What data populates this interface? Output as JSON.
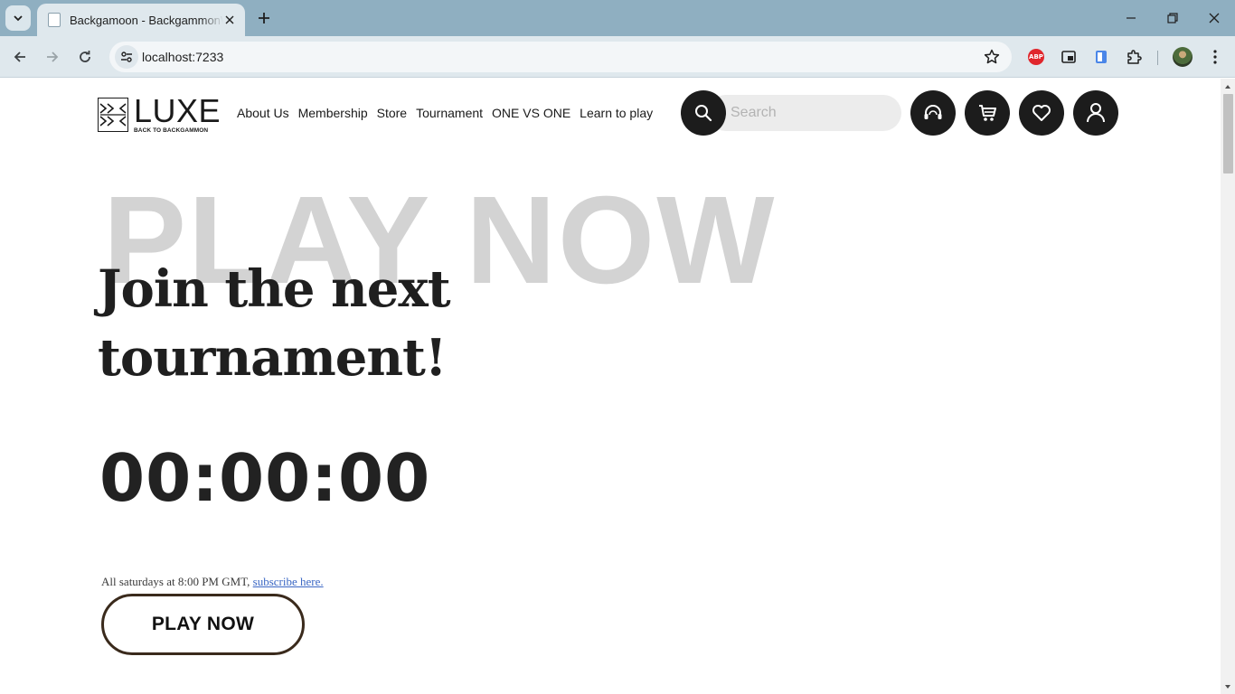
{
  "browser": {
    "tab_title": "Backgamoon - BackgammonWeb",
    "url": "localhost:7233",
    "icons": [
      "tab-search-icon",
      "favicon-icon",
      "close-icon",
      "plus-icon",
      "minimize-icon",
      "restore-icon",
      "window-close-icon",
      "back-icon",
      "forward-icon",
      "reload-icon",
      "site-info-icon",
      "star-icon",
      "adblock-icon",
      "picture-in-picture-icon",
      "clipboard-icon",
      "puzzle-icon",
      "profile-avatar",
      "kebab-menu-icon"
    ],
    "extension_abp_label": "ABP"
  },
  "header": {
    "logo": {
      "word": "LUXE",
      "tagline": "BACK TO BACKGAMMON"
    },
    "nav": [
      {
        "label": "About Us"
      },
      {
        "label": "Membership"
      },
      {
        "label": "Store"
      },
      {
        "label": "Tournament"
      },
      {
        "label": "ONE VS ONE"
      },
      {
        "label": "Learn to play"
      }
    ],
    "search": {
      "placeholder": "Search",
      "value": ""
    },
    "icon_buttons": [
      "support-headset-icon",
      "cart-icon",
      "heart-icon",
      "user-icon"
    ]
  },
  "hero": {
    "background_word": "PLAY NOW",
    "headline": "Join the next tournament!",
    "countdown": "00:00:00",
    "schedule_text": "All saturdays at 8:00 PM GMT, ",
    "subscribe_link": "subscribe here.",
    "cta_label": "PLAY NOW"
  },
  "colors": {
    "chrome_tabbar": "#8fafc1",
    "chrome_toolbar": "#dfe8ed",
    "icon_dark": "#1c1c1c",
    "bg_word": "#d3d3d3",
    "link": "#3b67c4",
    "cta_border": "#3a2a1c"
  }
}
